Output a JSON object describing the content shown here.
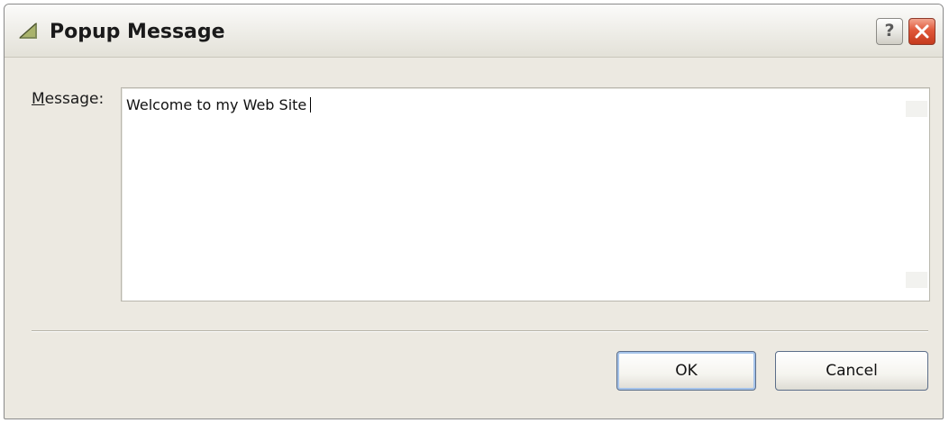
{
  "window": {
    "title": "Popup Message",
    "icon": "tool-icon",
    "help_glyph": "?",
    "close_icon": "close-icon"
  },
  "form": {
    "message_label_mnemonic": "M",
    "message_label_rest": "essage:",
    "message_value": "Welcome to my Web Site"
  },
  "buttons": {
    "ok_label": "OK",
    "cancel_label": "Cancel"
  },
  "colors": {
    "close_button": "#e0583a",
    "default_button_focus": "#a5c3ea",
    "dialog_background": "#ece9e1"
  }
}
